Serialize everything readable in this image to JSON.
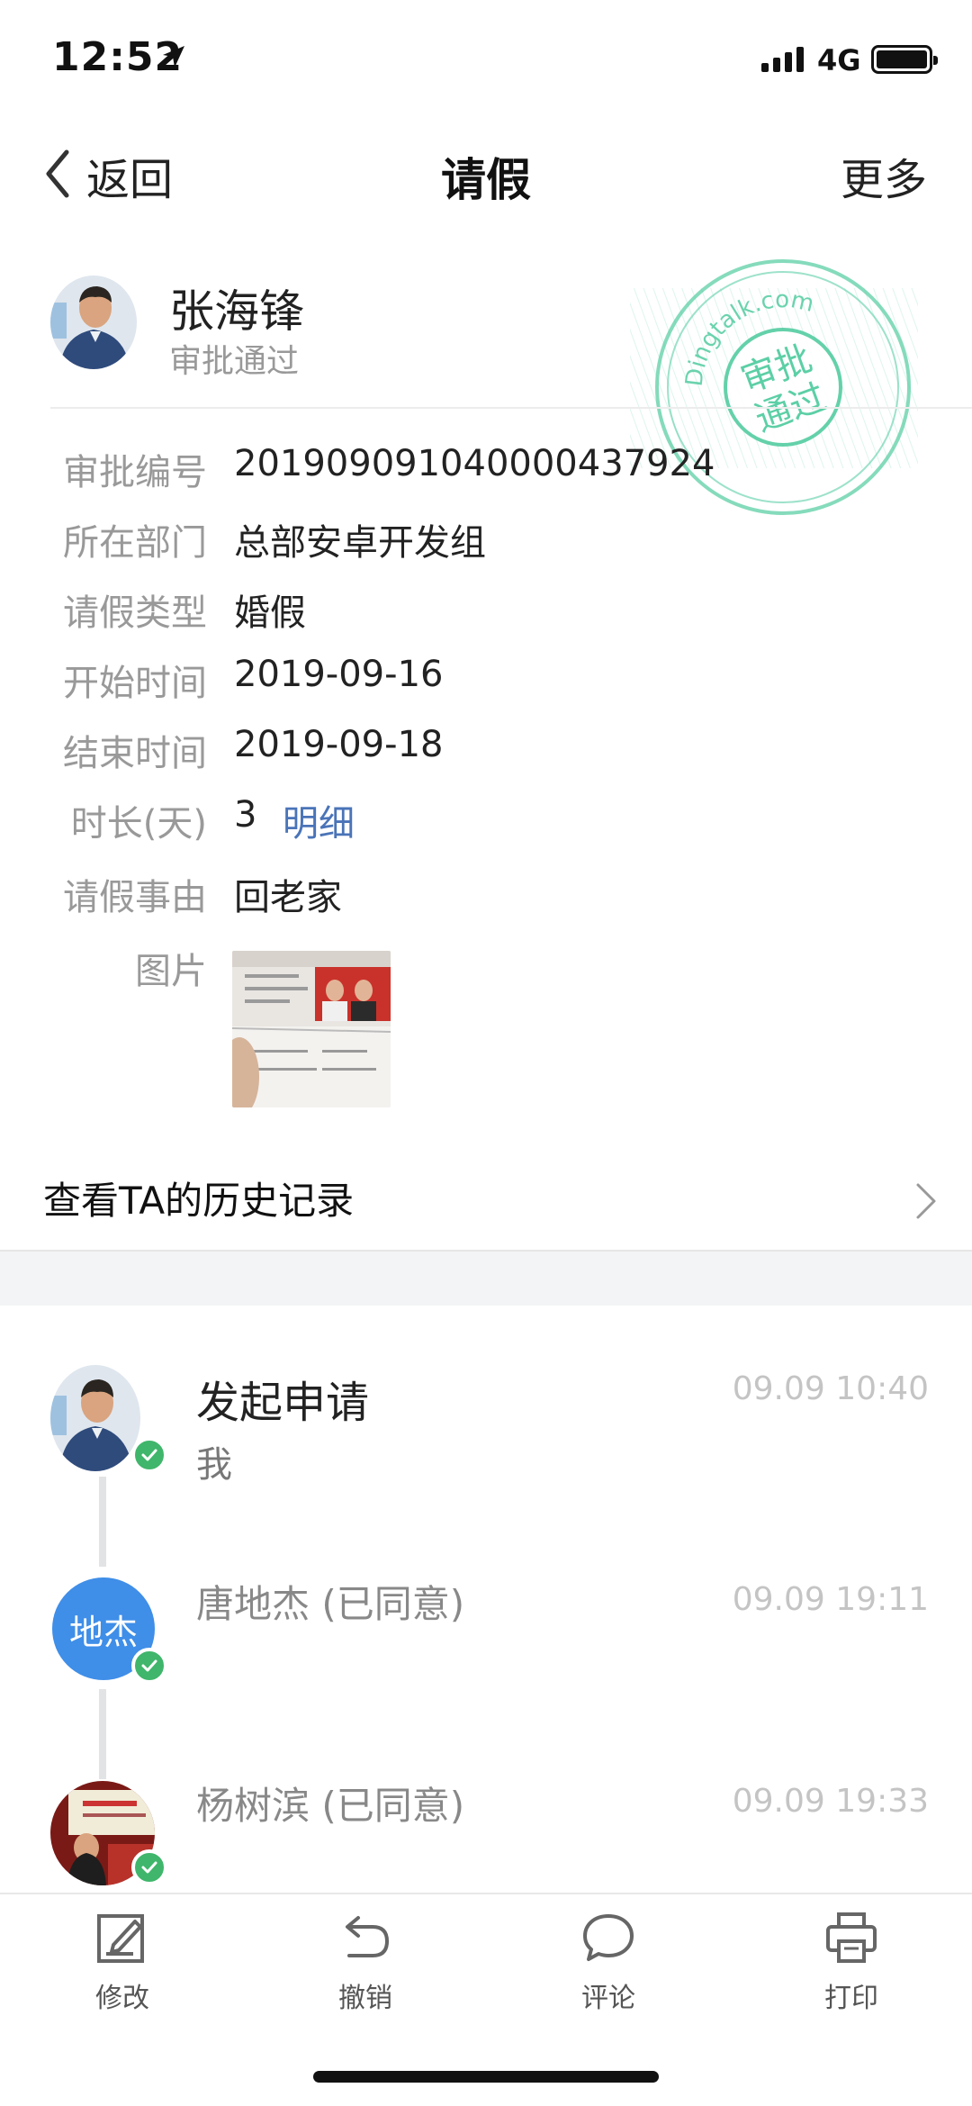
{
  "status_bar": {
    "time": "12:52",
    "network": "4G"
  },
  "nav": {
    "back_label": "返回",
    "title": "请假",
    "more_label": "更多"
  },
  "applicant": {
    "name": "张海锋",
    "status": "审批通过"
  },
  "stamp": {
    "text_line1": "审批",
    "text_line2": "通过",
    "ring_text": "Dingtalk.com",
    "color": "#5ccfa6"
  },
  "fields": [
    {
      "label": "审批编号",
      "value": "201909091040000437924"
    },
    {
      "label": "所在部门",
      "value": "总部安卓开发组"
    },
    {
      "label": "请假类型",
      "value": "婚假"
    },
    {
      "label": "开始时间",
      "value": "2019-09-16"
    },
    {
      "label": "结束时间",
      "value": "2019-09-18"
    },
    {
      "label": "时长(天)",
      "value": "3"
    },
    {
      "label": "请假事由",
      "value": "回老家"
    },
    {
      "label": "图片",
      "value": ""
    }
  ],
  "detail_link": "明细",
  "history_label": "查看TA的历史记录",
  "timeline": [
    {
      "title": "发起申请",
      "subtitle": "我",
      "time": "09.09 10:40"
    },
    {
      "title": "唐地杰 (已同意)",
      "avatar_text": "地杰",
      "time": "09.09 19:11"
    },
    {
      "title": "杨树滨 (已同意)",
      "time": "09.09 19:33"
    }
  ],
  "toolbar": {
    "edit": "修改",
    "revoke": "撤销",
    "comment": "评论",
    "print": "打印"
  },
  "colors": {
    "link": "#4a74b8",
    "check": "#3fb66b",
    "avatar_blue": "#3f8ee8"
  }
}
